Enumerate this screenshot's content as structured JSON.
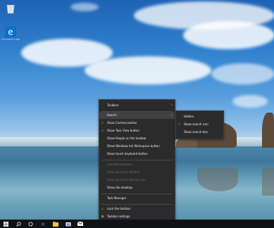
{
  "desktop": {
    "icons": [
      {
        "name": "Recycle Bin",
        "label": ""
      },
      {
        "name": "Microsoft Edge",
        "label": "Microsoft Edge"
      }
    ]
  },
  "context_menu": {
    "items": [
      {
        "label": "Toolbars",
        "checked": false,
        "submenu": true,
        "disabled": false
      },
      {
        "label": "Search",
        "checked": false,
        "submenu": true,
        "disabled": false,
        "highlighted": true
      },
      {
        "label": "Show Cortana button",
        "checked": true,
        "submenu": false,
        "disabled": false
      },
      {
        "label": "Show Task View button",
        "checked": true,
        "submenu": false,
        "disabled": false
      },
      {
        "label": "Show People on the taskbar",
        "checked": false,
        "submenu": false,
        "disabled": false
      },
      {
        "label": "Show Windows Ink Workspace button",
        "checked": false,
        "submenu": false,
        "disabled": false
      },
      {
        "label": "Show touch keyboard button",
        "checked": false,
        "submenu": false,
        "disabled": false
      },
      {
        "label": "Cascade windows",
        "checked": false,
        "submenu": false,
        "disabled": true
      },
      {
        "label": "Show windows stacked",
        "checked": false,
        "submenu": false,
        "disabled": true
      },
      {
        "label": "Show windows side by side",
        "checked": false,
        "submenu": false,
        "disabled": true
      },
      {
        "label": "Show the desktop",
        "checked": false,
        "submenu": false,
        "disabled": false
      },
      {
        "label": "Task Manager",
        "checked": false,
        "submenu": false,
        "disabled": false
      },
      {
        "label": "Lock the taskbar",
        "checked": true,
        "submenu": false,
        "disabled": false
      },
      {
        "label": "Taskbar settings",
        "checked": false,
        "submenu": false,
        "disabled": false,
        "icon": "gear-icon"
      }
    ]
  },
  "search_submenu": {
    "items": [
      {
        "label": "Hidden",
        "checked": false
      },
      {
        "label": "Show search icon",
        "checked": true
      },
      {
        "label": "Show search box",
        "checked": false
      }
    ]
  },
  "taskbar": {
    "items": [
      "start-icon",
      "search-icon",
      "task-view-icon",
      "edge-icon",
      "file-explorer-icon",
      "store-icon",
      "mail-icon"
    ]
  },
  "colors": {
    "menu_bg": "#2b2b2b",
    "menu_text": "#f2f2f2",
    "disabled_text": "#6d6d6d",
    "highlight": "#414141",
    "taskbar": "#101215"
  }
}
